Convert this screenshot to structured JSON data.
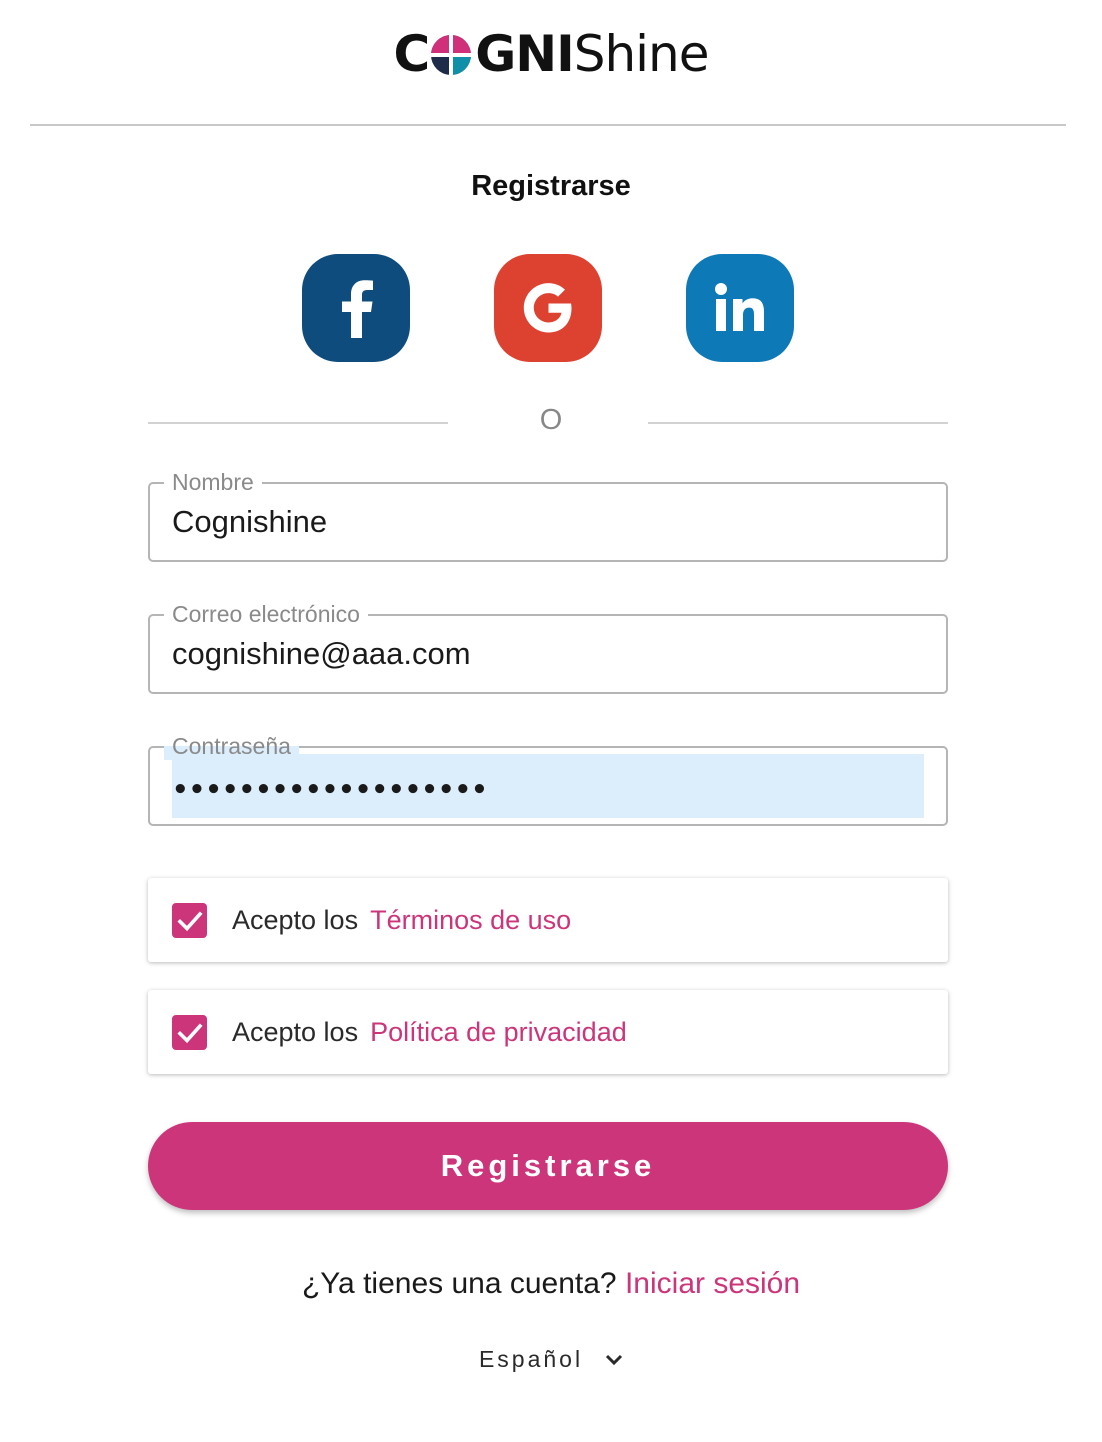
{
  "brand": {
    "logo_bold_1": "C",
    "logo_bold_2": "GNI",
    "logo_light": "Shine",
    "logo_colors": [
      "#d02f79",
      "#0f8fa8",
      "#1e2c4a"
    ]
  },
  "page": {
    "title": "Registrarse"
  },
  "social": {
    "facebook": {
      "icon": "facebook-icon",
      "color": "#0e4c7d"
    },
    "google": {
      "icon": "google-icon",
      "color": "#dd4231"
    },
    "linkedin": {
      "icon": "linkedin-icon",
      "color": "#0e79b7"
    }
  },
  "divider": {
    "or_text": "O"
  },
  "form": {
    "name": {
      "label": "Nombre",
      "value": "Cognishine"
    },
    "email": {
      "label": "Correo electrónico",
      "value": "cognishine@aaa.com"
    },
    "password": {
      "label": "Contraseña",
      "value": "•••••••••••••••••••"
    }
  },
  "consents": {
    "terms": {
      "prefix": "Acepto los",
      "link": "Términos de uso",
      "checked": true
    },
    "privacy": {
      "prefix": "Acepto los",
      "link": "Política de privacidad",
      "checked": true
    }
  },
  "actions": {
    "register_label": "Registrarse",
    "have_account": "¿Ya tienes una cuenta?",
    "login_link": "Iniciar sesión"
  },
  "language": {
    "selected": "Español"
  },
  "colors": {
    "accent": "#cc357a",
    "field_border": "#b5b5b5",
    "autofill_bg": "#dcedfc"
  }
}
